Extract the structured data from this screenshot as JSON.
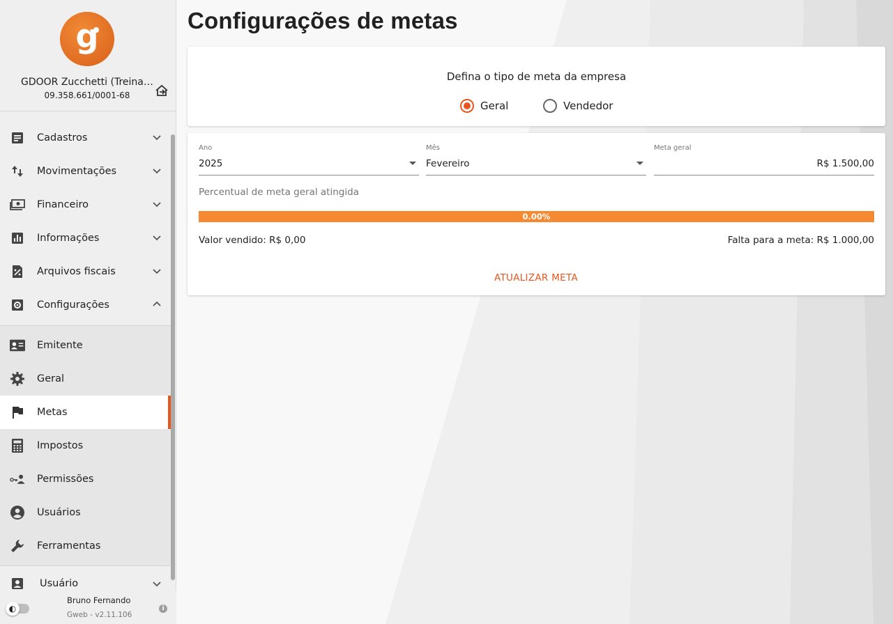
{
  "company": {
    "logo_letter": "g",
    "name": "GDOOR Zucchetti (Treinamento)",
    "cnpj": "09.358.661/0001-68"
  },
  "menu": [
    {
      "label": "Cadastros",
      "icon": "document-icon",
      "chevron": "down"
    },
    {
      "label": "Movimentações",
      "icon": "swap-vertical-icon",
      "chevron": "down"
    },
    {
      "label": "Financeiro",
      "icon": "cash-icon",
      "chevron": "down"
    },
    {
      "label": "Informações",
      "icon": "bar-chart-icon",
      "chevron": "down"
    },
    {
      "label": "Arquivos fiscais",
      "icon": "percent-file-icon",
      "chevron": "down"
    },
    {
      "label": "Configurações",
      "icon": "gear-box-icon",
      "chevron": "up"
    }
  ],
  "submenu": [
    {
      "label": "Emitente",
      "icon": "id-card-icon"
    },
    {
      "label": "Geral",
      "icon": "gear-icon"
    },
    {
      "label": "Metas",
      "icon": "flag-icon",
      "active": true
    },
    {
      "label": "Impostos",
      "icon": "calculator-icon"
    },
    {
      "label": "Permissões",
      "icon": "key-user-icon"
    },
    {
      "label": "Usuários",
      "icon": "user-circle-icon"
    },
    {
      "label": "Ferramentas",
      "icon": "wrench-icon"
    }
  ],
  "user_menu": {
    "label": "Usuário",
    "icon": "user-box-icon"
  },
  "footer": {
    "user_name": "Bruno Fernando",
    "version": "Gweb - v2.11.106",
    "info": "i",
    "theme_icon": "◐"
  },
  "page": {
    "title": "Configurações de metas"
  },
  "goal_type": {
    "title": "Defina o tipo de meta da empresa",
    "options": [
      {
        "label": "Geral",
        "checked": true
      },
      {
        "label": "Vendedor",
        "checked": false
      }
    ]
  },
  "form": {
    "year": {
      "label": "Ano",
      "value": "2025"
    },
    "month": {
      "label": "Mês",
      "value": "Fevereiro"
    },
    "goal": {
      "label": "Meta geral",
      "value": "R$ 1.500,00"
    }
  },
  "progress": {
    "label": "Percentual de meta geral atingida",
    "percent": 0,
    "text": "0.00%"
  },
  "summary": {
    "sold": "Valor vendido: R$ 0,00",
    "missing": "Falta para a meta: R$ 1.000,00"
  },
  "actions": {
    "update": "ATUALIZAR META"
  },
  "colors": {
    "accent": "#e8561f",
    "progress": "#f58a33"
  }
}
